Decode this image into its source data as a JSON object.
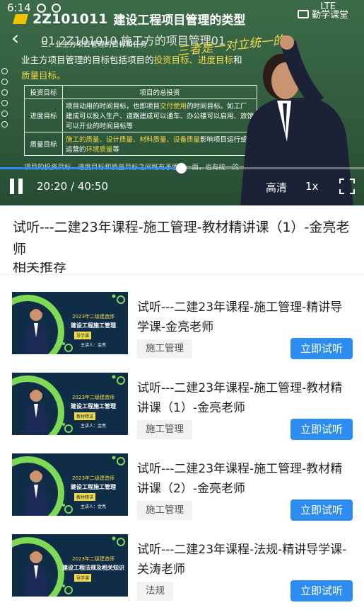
{
  "status_bar": {
    "time": "6:14",
    "network": "LTE"
  },
  "player": {
    "chapter_code": "2Z101011",
    "chapter_title": "建设工程项目管理的类型",
    "brand": "勤学课堂",
    "slide_subtitle": "01 2Z101010 施工方的项目管理01",
    "slide_heading": "三、业主方项目管理的目标和任务",
    "slide_line_prefix": "业主方项目管理的目标包括项目的",
    "slide_line_highlight": "投资目标、进度目标",
    "slide_line_tail": "和",
    "slide_line_end": "质量目标。",
    "signature": "三者是一对立统一的",
    "table": {
      "headers": [
        "投资目标",
        "项目的总投资"
      ],
      "rows": [
        {
          "label": "进度目标",
          "pre": "项目动用的时间目标，也即项目",
          "hl": "交付使用",
          "post": "的时间目标。如工厂建成可以投入生产、道路建成可以通车、办公楼可以启用、旅馆可以开业的时间目标等"
        },
        {
          "label": "质量目标",
          "pre": "",
          "hl": "施工的质量、设计质量、材料质量、设备质量",
          "post": "影响项目运行或运营的",
          "hl2": "环境质量",
          "post2": "等"
        }
      ]
    },
    "slide_footer": "项目的投资目标、进度目标和质量目标之间既有矛盾的一面，也有统一的一面，它们之间的关系是对立统一的关系。",
    "current_time": "20:20",
    "total_time": "40:50",
    "time_display": "20:20 / 40:50",
    "progress": 0.498,
    "quality": "高清",
    "speed": "1x"
  },
  "course_title": "试听---二建23年课程-施工管理-教材精讲课（1）-金亮老师",
  "section_heading": "相关推荐",
  "recommendations": [
    {
      "title": "试听---二建23年课程-施工管理-精讲导学课-金亮老师",
      "tag": "施工管理",
      "button": "立即试听",
      "thumb": {
        "year": "2023年二级建造师",
        "course": "建设工程施工管理",
        "type": "导学课",
        "lecturer": "主讲人：金亮"
      }
    },
    {
      "title": "试听---二建23年课程-施工管理-教材精讲课（1）-金亮老师",
      "tag": "施工管理",
      "button": "立即试听",
      "thumb": {
        "year": "2023年二级建造师",
        "course": "建设工程施工管理",
        "type": "教材精讲",
        "lecturer": "主讲人：金亮"
      }
    },
    {
      "title": "试听---二建23年课程-施工管理-教材精讲课（2）-金亮老师",
      "tag": "施工管理",
      "button": "立即试听",
      "thumb": {
        "year": "2023年二级建造师",
        "course": "建设工程施工管理",
        "type": "教材精讲",
        "lecturer": "主讲人：金亮"
      }
    },
    {
      "title": "试听---二建23年课程-法规-精讲导学课-关涛老师",
      "tag": "法规",
      "button": "立即试听",
      "thumb": {
        "year": "2023年二级建造师",
        "course": "建设工程法规及相关知识",
        "type": "导学课",
        "lecturer": ""
      }
    }
  ],
  "colors": {
    "accent": "#2d8cf0",
    "board": "#2f5a3c",
    "highlight": "#f3d94a",
    "ring": "#7ed957"
  }
}
